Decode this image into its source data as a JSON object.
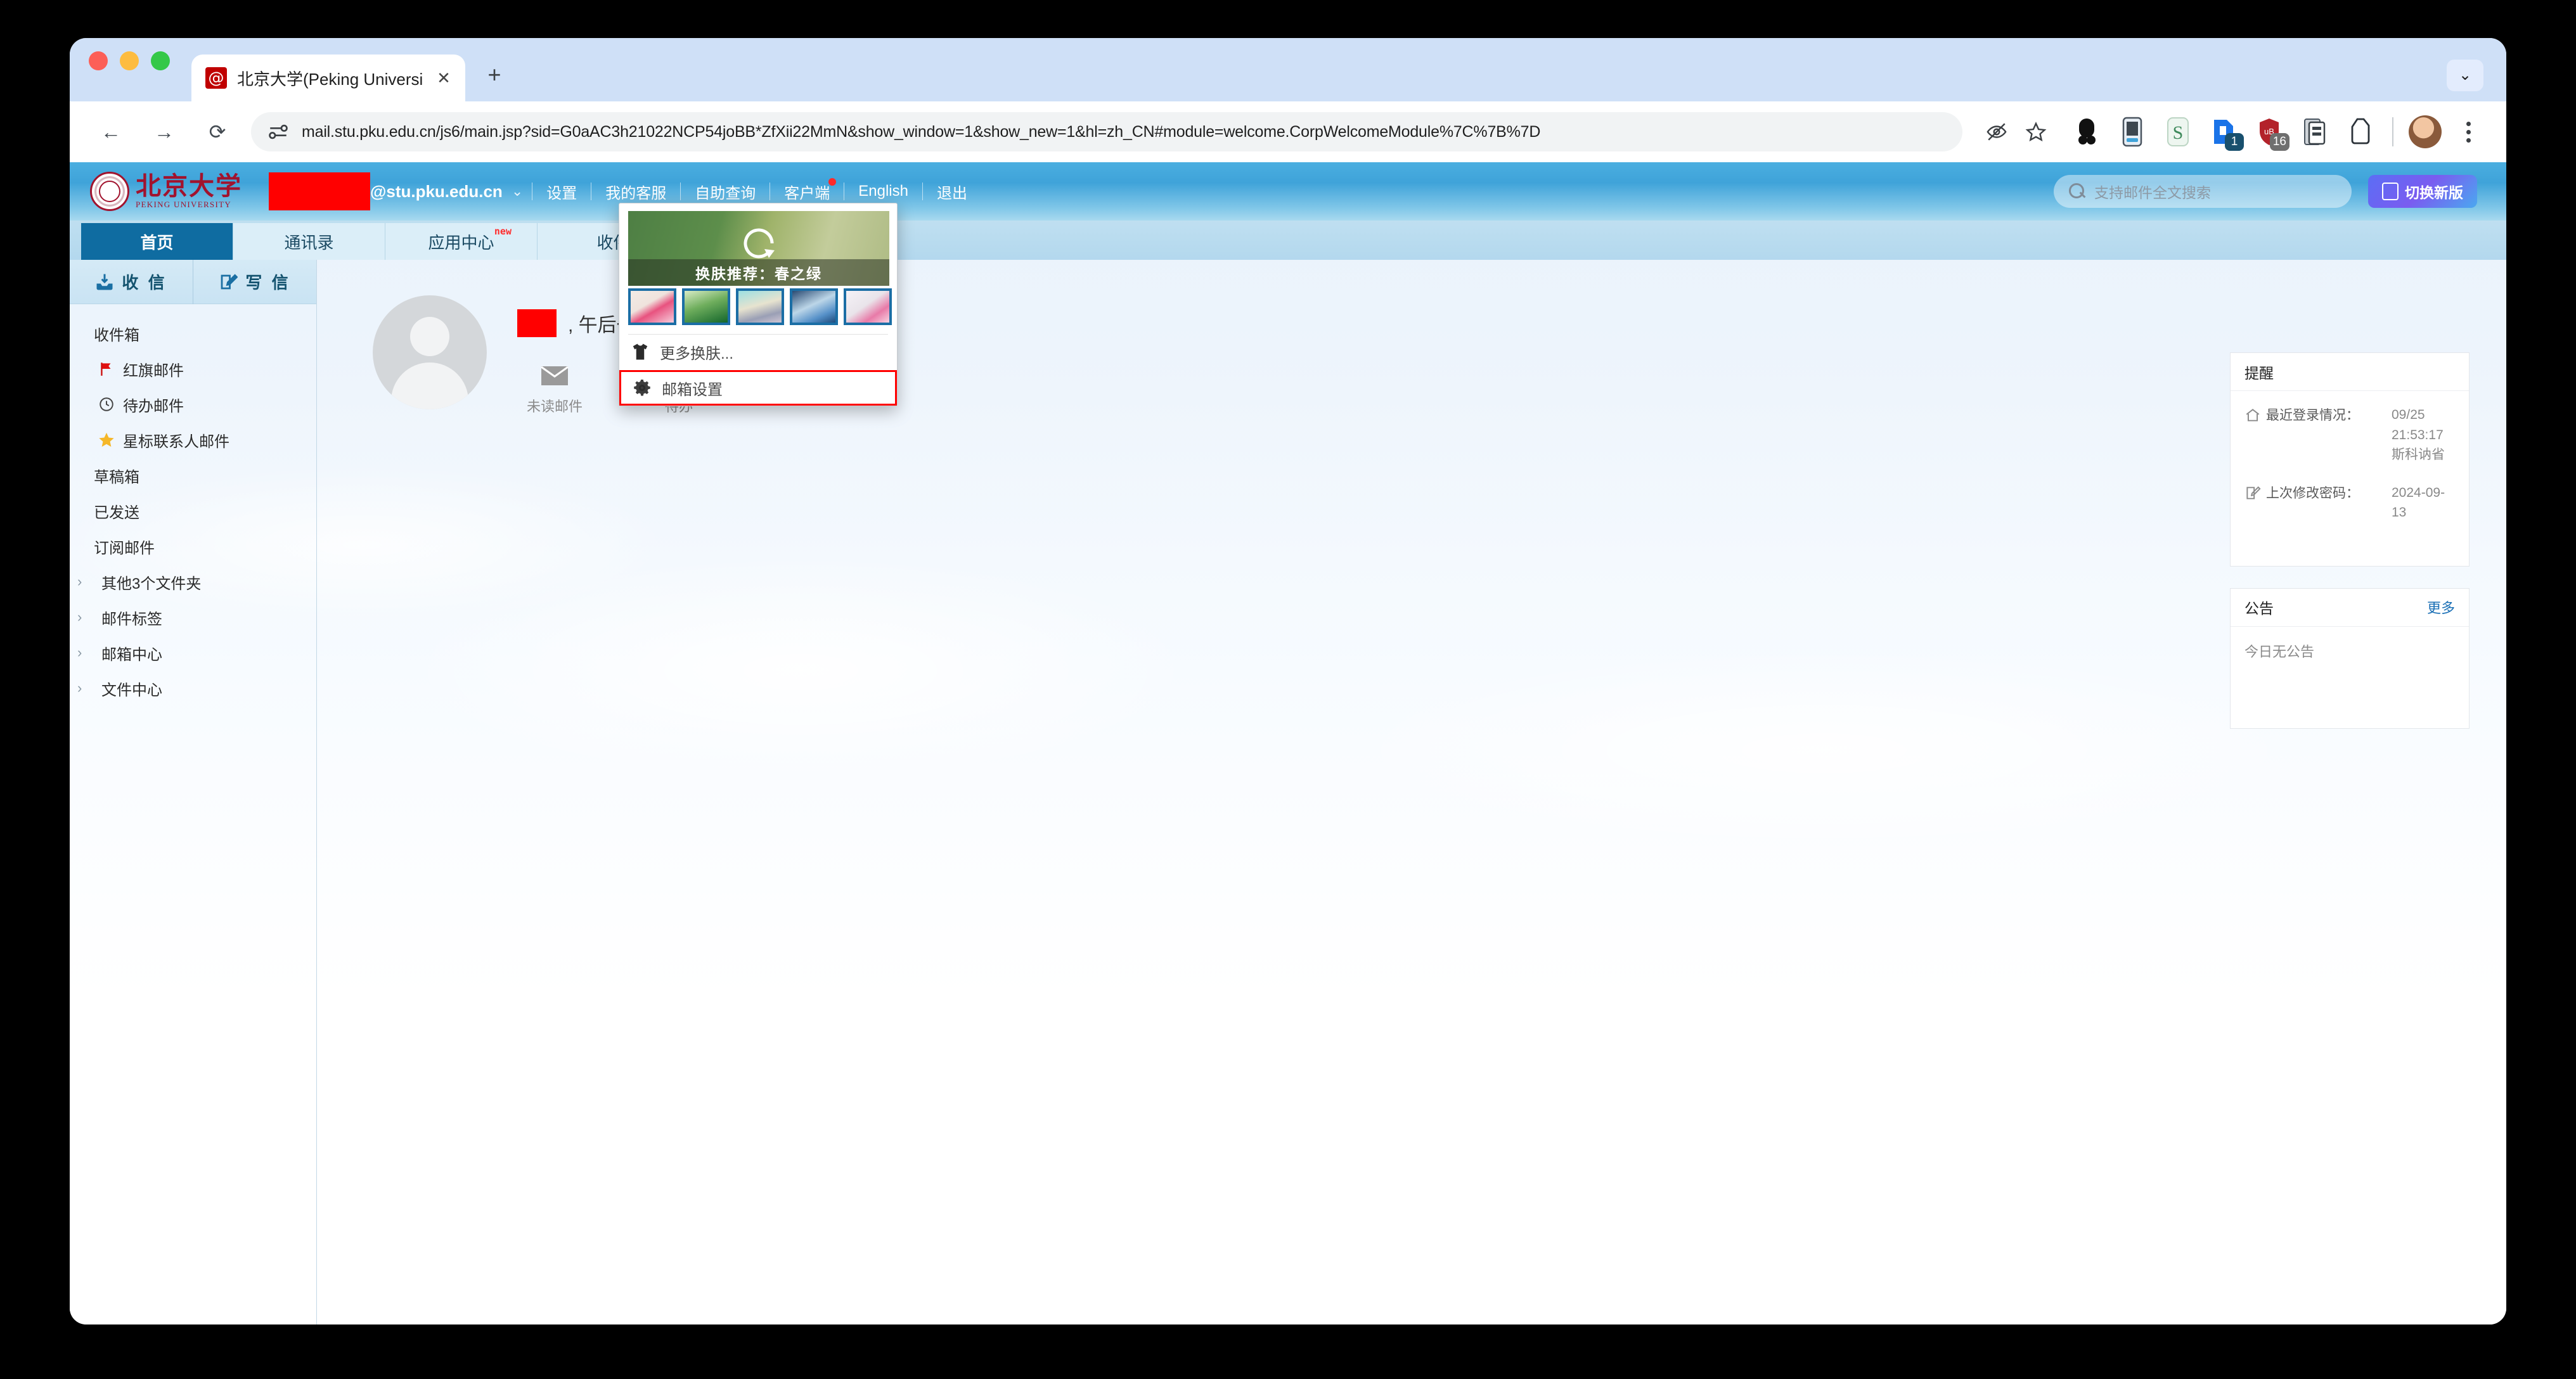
{
  "browser": {
    "tab": {
      "title": "北京大学(Peking University)",
      "favicon_glyph": "@",
      "close_label": "✕"
    },
    "new_tab_label": "+",
    "tab_search_glyph": "⌄",
    "nav": {
      "back_glyph": "←",
      "forward_glyph": "→",
      "reload_glyph": "⟳"
    },
    "omnibox": {
      "url": "mail.stu.pku.edu.cn/js6/main.jsp?sid=G0aAC3h21022NCP54joBB*ZfXii22MmN&show_window=1&show_new=1&hl=zh_CN#module=welcome.CorpWelcomeModule%7C%7B%7D"
    },
    "extensions": [
      {
        "name": "ext-black-oval",
        "badge": null
      },
      {
        "name": "ext-device",
        "badge": null
      },
      {
        "name": "ext-s-letter",
        "badge": null
      },
      {
        "name": "ext-blue-note",
        "badge": "1",
        "badge_color": "#19506e"
      },
      {
        "name": "ext-red-shield",
        "badge": "16",
        "badge_color": "#6f6f6f"
      },
      {
        "name": "ext-clipboard",
        "badge": null
      },
      {
        "name": "ext-outline",
        "badge": null
      }
    ]
  },
  "mail_header": {
    "logo_cn": "北京大学",
    "logo_en": "PEKING UNIVERSITY",
    "account_domain": "@stu.pku.edu.cn",
    "account_caret": "⌄",
    "menu": [
      {
        "label": "设置",
        "dot": false
      },
      {
        "label": "我的客服",
        "dot": false
      },
      {
        "label": "自助查询",
        "dot": false
      },
      {
        "label": "客户端",
        "dot": true
      },
      {
        "label": "English",
        "dot": false
      },
      {
        "label": "退出",
        "dot": false
      }
    ],
    "search_placeholder": "支持邮件全文搜索",
    "switch_version_label": "切换新版"
  },
  "nav_tabs": [
    {
      "label": "首页",
      "active": true,
      "badge": null
    },
    {
      "label": "通讯录",
      "active": false,
      "badge": null
    },
    {
      "label": "应用中心",
      "active": false,
      "badge": "new"
    },
    {
      "label": "收件",
      "active": false,
      "badge": null
    }
  ],
  "sidebar": {
    "actions": [
      {
        "label": "收 信",
        "icon": "inbox-download-icon"
      },
      {
        "label": "写 信",
        "icon": "compose-pencil-icon"
      }
    ],
    "folders": [
      {
        "label": "收件箱",
        "icon": null,
        "chevron": false
      },
      {
        "label": "红旗邮件",
        "icon": "red-flag-icon",
        "chevron": false,
        "indented": true
      },
      {
        "label": "待办邮件",
        "icon": "clock-icon",
        "chevron": false,
        "indented": true
      },
      {
        "label": "星标联系人邮件",
        "icon": "star-icon",
        "chevron": false,
        "indented": true
      },
      {
        "label": "草稿箱",
        "icon": null,
        "chevron": false
      },
      {
        "label": "已发送",
        "icon": null,
        "chevron": false
      },
      {
        "label": "订阅邮件",
        "icon": null,
        "chevron": false
      },
      {
        "label": "其他3个文件夹",
        "icon": null,
        "chevron": true
      },
      {
        "label": "邮件标签",
        "icon": null,
        "chevron": true
      },
      {
        "label": "邮箱中心",
        "icon": null,
        "chevron": true
      },
      {
        "label": "文件中心",
        "icon": null,
        "chevron": true
      }
    ],
    "chevron_glyph": "›"
  },
  "welcome": {
    "greeting_text": ", 午后一",
    "stats": [
      {
        "label": "未读邮件",
        "icon": "envelope-icon"
      },
      {
        "label": "待办",
        "icon": "clock-icon"
      }
    ]
  },
  "right_rail": {
    "reminder": {
      "title": "提醒",
      "rows": [
        {
          "icon": "home-icon",
          "label": "最近登录情况：",
          "value": "09/25 21:53:17\n斯科讷省"
        },
        {
          "icon": "edit-icon",
          "label": "上次修改密码：",
          "value": "2024-09-13"
        }
      ]
    },
    "announcement": {
      "title": "公告",
      "more_label": "更多",
      "empty_text": "今日无公告"
    }
  },
  "skin_dropdown": {
    "hero_caption": "换肤推荐：春之绿",
    "thumbnails": [
      "skin-pink-floral",
      "skin-green-pine",
      "skin-teddy-bear",
      "skin-blue-horse",
      "skin-cherry-blossom"
    ],
    "more_skins_label": "更多换肤...",
    "mail_settings_label": "邮箱设置",
    "highlight_color": "#ff0000"
  }
}
